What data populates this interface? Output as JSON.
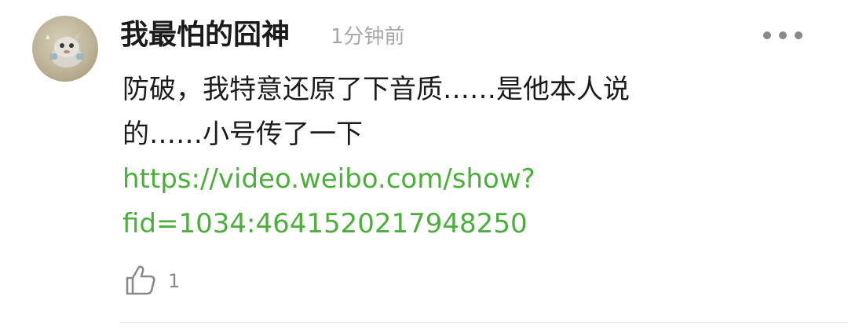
{
  "comment": {
    "username": "我最怕的囧神",
    "time": "1分钟前",
    "text_line1": "防破，我特意还原了下音质……是他本人说",
    "text_line2": "的……小号传了一下",
    "link_line1": "https://video.weibo.com/show?",
    "link_line2": "fid=1034:4641520217948250",
    "like_count": "1"
  },
  "icons": {
    "avatar": "avatar",
    "more": "more-horizontal-icon",
    "like": "thumbs-up-icon"
  },
  "colors": {
    "username": "#1a1a1a",
    "time": "#a8a8a8",
    "body_text": "#1c1c1c",
    "link": "#4caf3c",
    "icon_gray": "#8a8a8a"
  }
}
